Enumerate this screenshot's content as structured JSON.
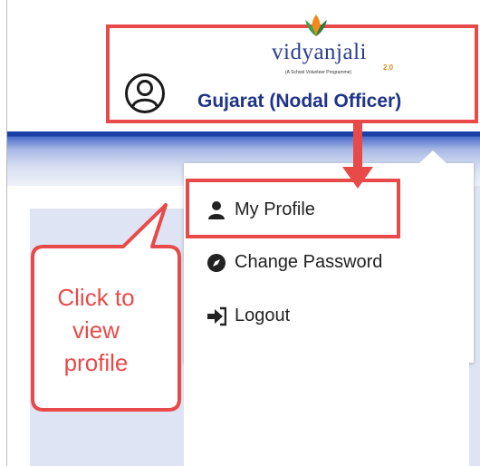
{
  "header": {
    "logo_word": "vidyanjali",
    "logo_version": "2.0",
    "logo_tagline": "(A School Volunteer Programme)",
    "user_name": "Gujarat (Nodal Officer)"
  },
  "menu": {
    "items": [
      {
        "label": "My Profile",
        "icon": "user-icon"
      },
      {
        "label": "Change Password",
        "icon": "compass-icon"
      },
      {
        "label": "Logout",
        "icon": "logout-icon"
      }
    ]
  },
  "annotation": {
    "callout_lines": [
      "Click to",
      "view",
      "profile"
    ],
    "highlight_color": "#e84a4a"
  },
  "colors": {
    "brand_blue": "#1f3488",
    "band_blue": "#1a3fa6",
    "panel": "#dfe4f4"
  }
}
